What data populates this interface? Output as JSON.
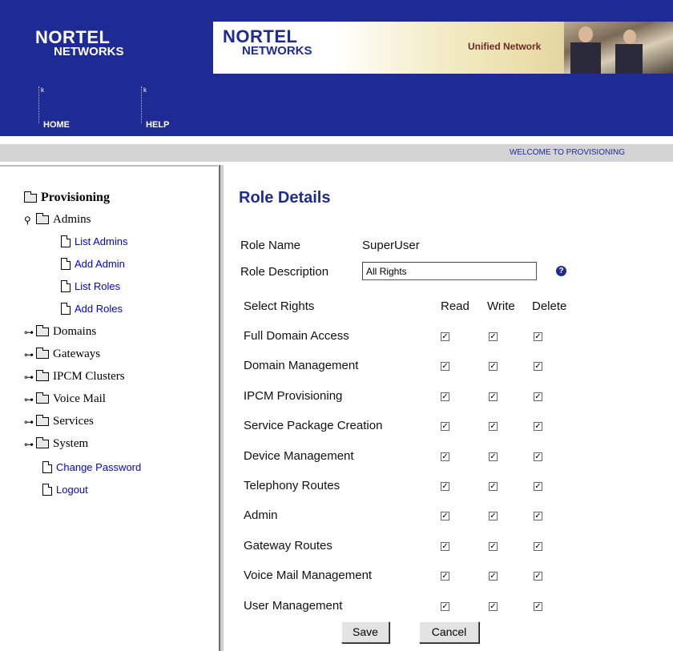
{
  "header": {
    "logo_line1": "NORTEL",
    "logo_line2": "NETWORKS",
    "banner_logo_line1": "NORTEL",
    "banner_logo_line2": "NETWORKS",
    "banner_text": "Unified Network",
    "nav": [
      {
        "label": "HOME"
      },
      {
        "label": "HELP"
      }
    ],
    "brand_color": "#1f2b95"
  },
  "welcome_text": "WELCOME TO PROVISIONING",
  "tree": {
    "root": "Provisioning",
    "admins": {
      "label": "Admins",
      "children": [
        "List Admins",
        "Add Admin",
        "List Roles",
        "Add Roles"
      ]
    },
    "folders": [
      "Domains",
      "Gateways",
      "IPCM Clusters",
      "Voice Mail",
      "Services",
      "System"
    ],
    "links": [
      "Change Password",
      "Logout"
    ],
    "link_color": "#0000ee"
  },
  "main": {
    "title": "Role Details",
    "role_name_label": "Role Name",
    "role_name_value": "SuperUser",
    "role_desc_label": "Role Description",
    "role_desc_value": "All Rights",
    "help_icon": "question-circle-icon",
    "rights_header": "Select Rights",
    "col_read": "Read",
    "col_write": "Write",
    "col_delete": "Delete",
    "rights": [
      {
        "name": "Full Domain Access",
        "read": true,
        "write": true,
        "delete": true
      },
      {
        "name": "Domain Management",
        "read": true,
        "write": true,
        "delete": true
      },
      {
        "name": "IPCM Provisioning",
        "read": true,
        "write": true,
        "delete": true
      },
      {
        "name": "Service Package Creation",
        "read": true,
        "write": true,
        "delete": true
      },
      {
        "name": "Device Management",
        "read": true,
        "write": true,
        "delete": true
      },
      {
        "name": "Telephony Routes",
        "read": true,
        "write": true,
        "delete": true
      },
      {
        "name": "Admin",
        "read": true,
        "write": true,
        "delete": true
      },
      {
        "name": "Gateway Routes",
        "read": true,
        "write": true,
        "delete": true
      },
      {
        "name": "Voice Mail Management",
        "read": true,
        "write": true,
        "delete": true
      },
      {
        "name": "User Management",
        "read": true,
        "write": true,
        "delete": true
      }
    ],
    "save_label": "Save",
    "cancel_label": "Cancel",
    "check_glyph": "✓"
  }
}
